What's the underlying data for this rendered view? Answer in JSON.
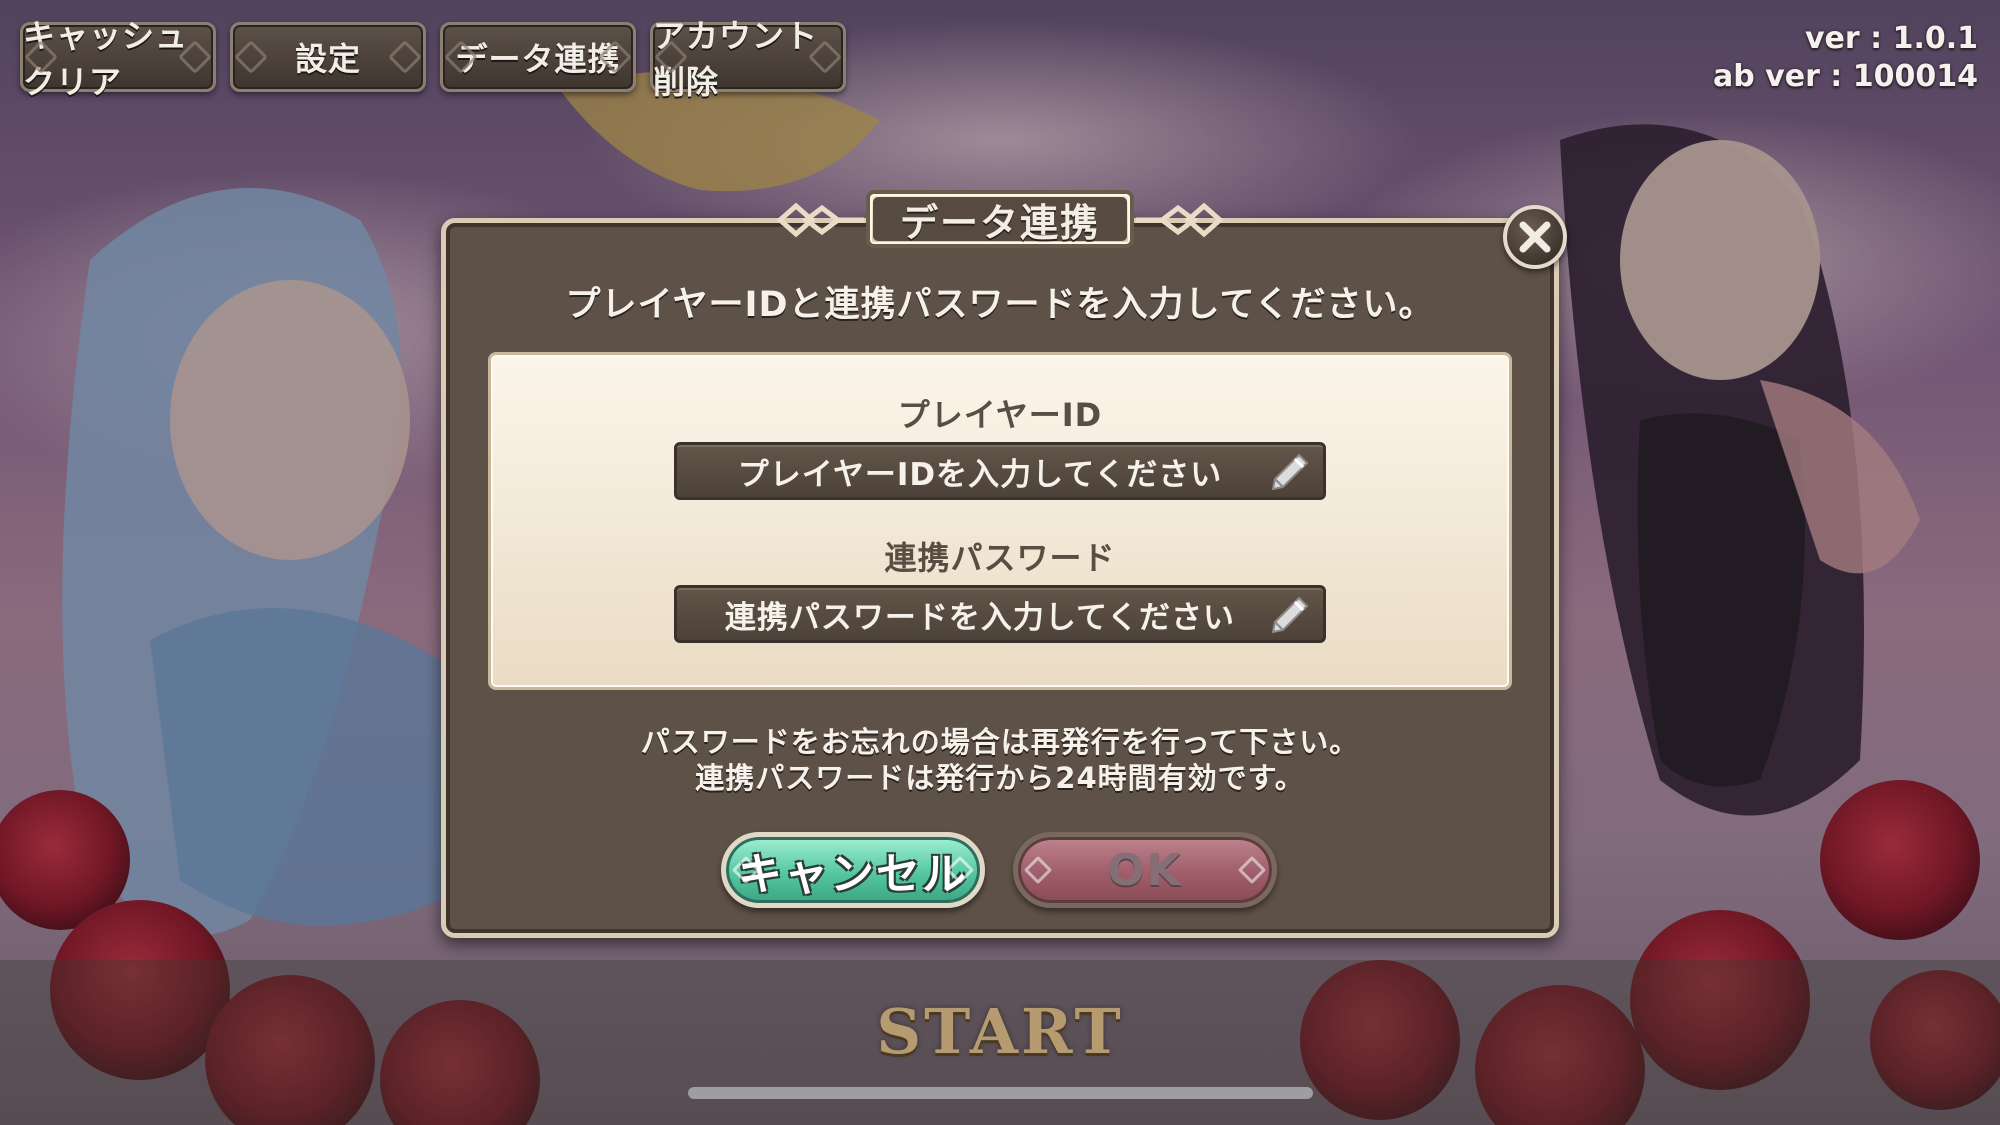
{
  "top_menu": {
    "items": [
      {
        "label": "キャッシュクリア"
      },
      {
        "label": "設定"
      },
      {
        "label": "データ連携"
      },
      {
        "label": "アカウント削除"
      }
    ]
  },
  "version": {
    "app": "ver : 1.0.1",
    "ab": "ab ver : 100014"
  },
  "dialog": {
    "title": "データ連携",
    "instruction": "プレイヤーIDと連携パスワードを入力してください。",
    "player_id": {
      "label": "プレイヤーID",
      "placeholder": "プレイヤーIDを入力してください"
    },
    "password": {
      "label": "連携パスワード",
      "placeholder": "連携パスワードを入力してください"
    },
    "note_line1": "パスワードをお忘れの場合は再発行を行って下さい。",
    "note_line2": "連携パスワードは発行から24時間有効です。",
    "cancel_label": "キャンセル",
    "ok_label": "OK"
  },
  "start_label": "START",
  "icons": {
    "close": "close-icon",
    "pencil": "pencil-icon"
  },
  "colors": {
    "dialog_bg": "#5e5147",
    "dialog_border": "#d9cbb4",
    "panel_bg": "#f4ead8",
    "cancel_button": "#56c7a2",
    "ok_button": "#a7606e",
    "field_bg": "#574a40"
  }
}
